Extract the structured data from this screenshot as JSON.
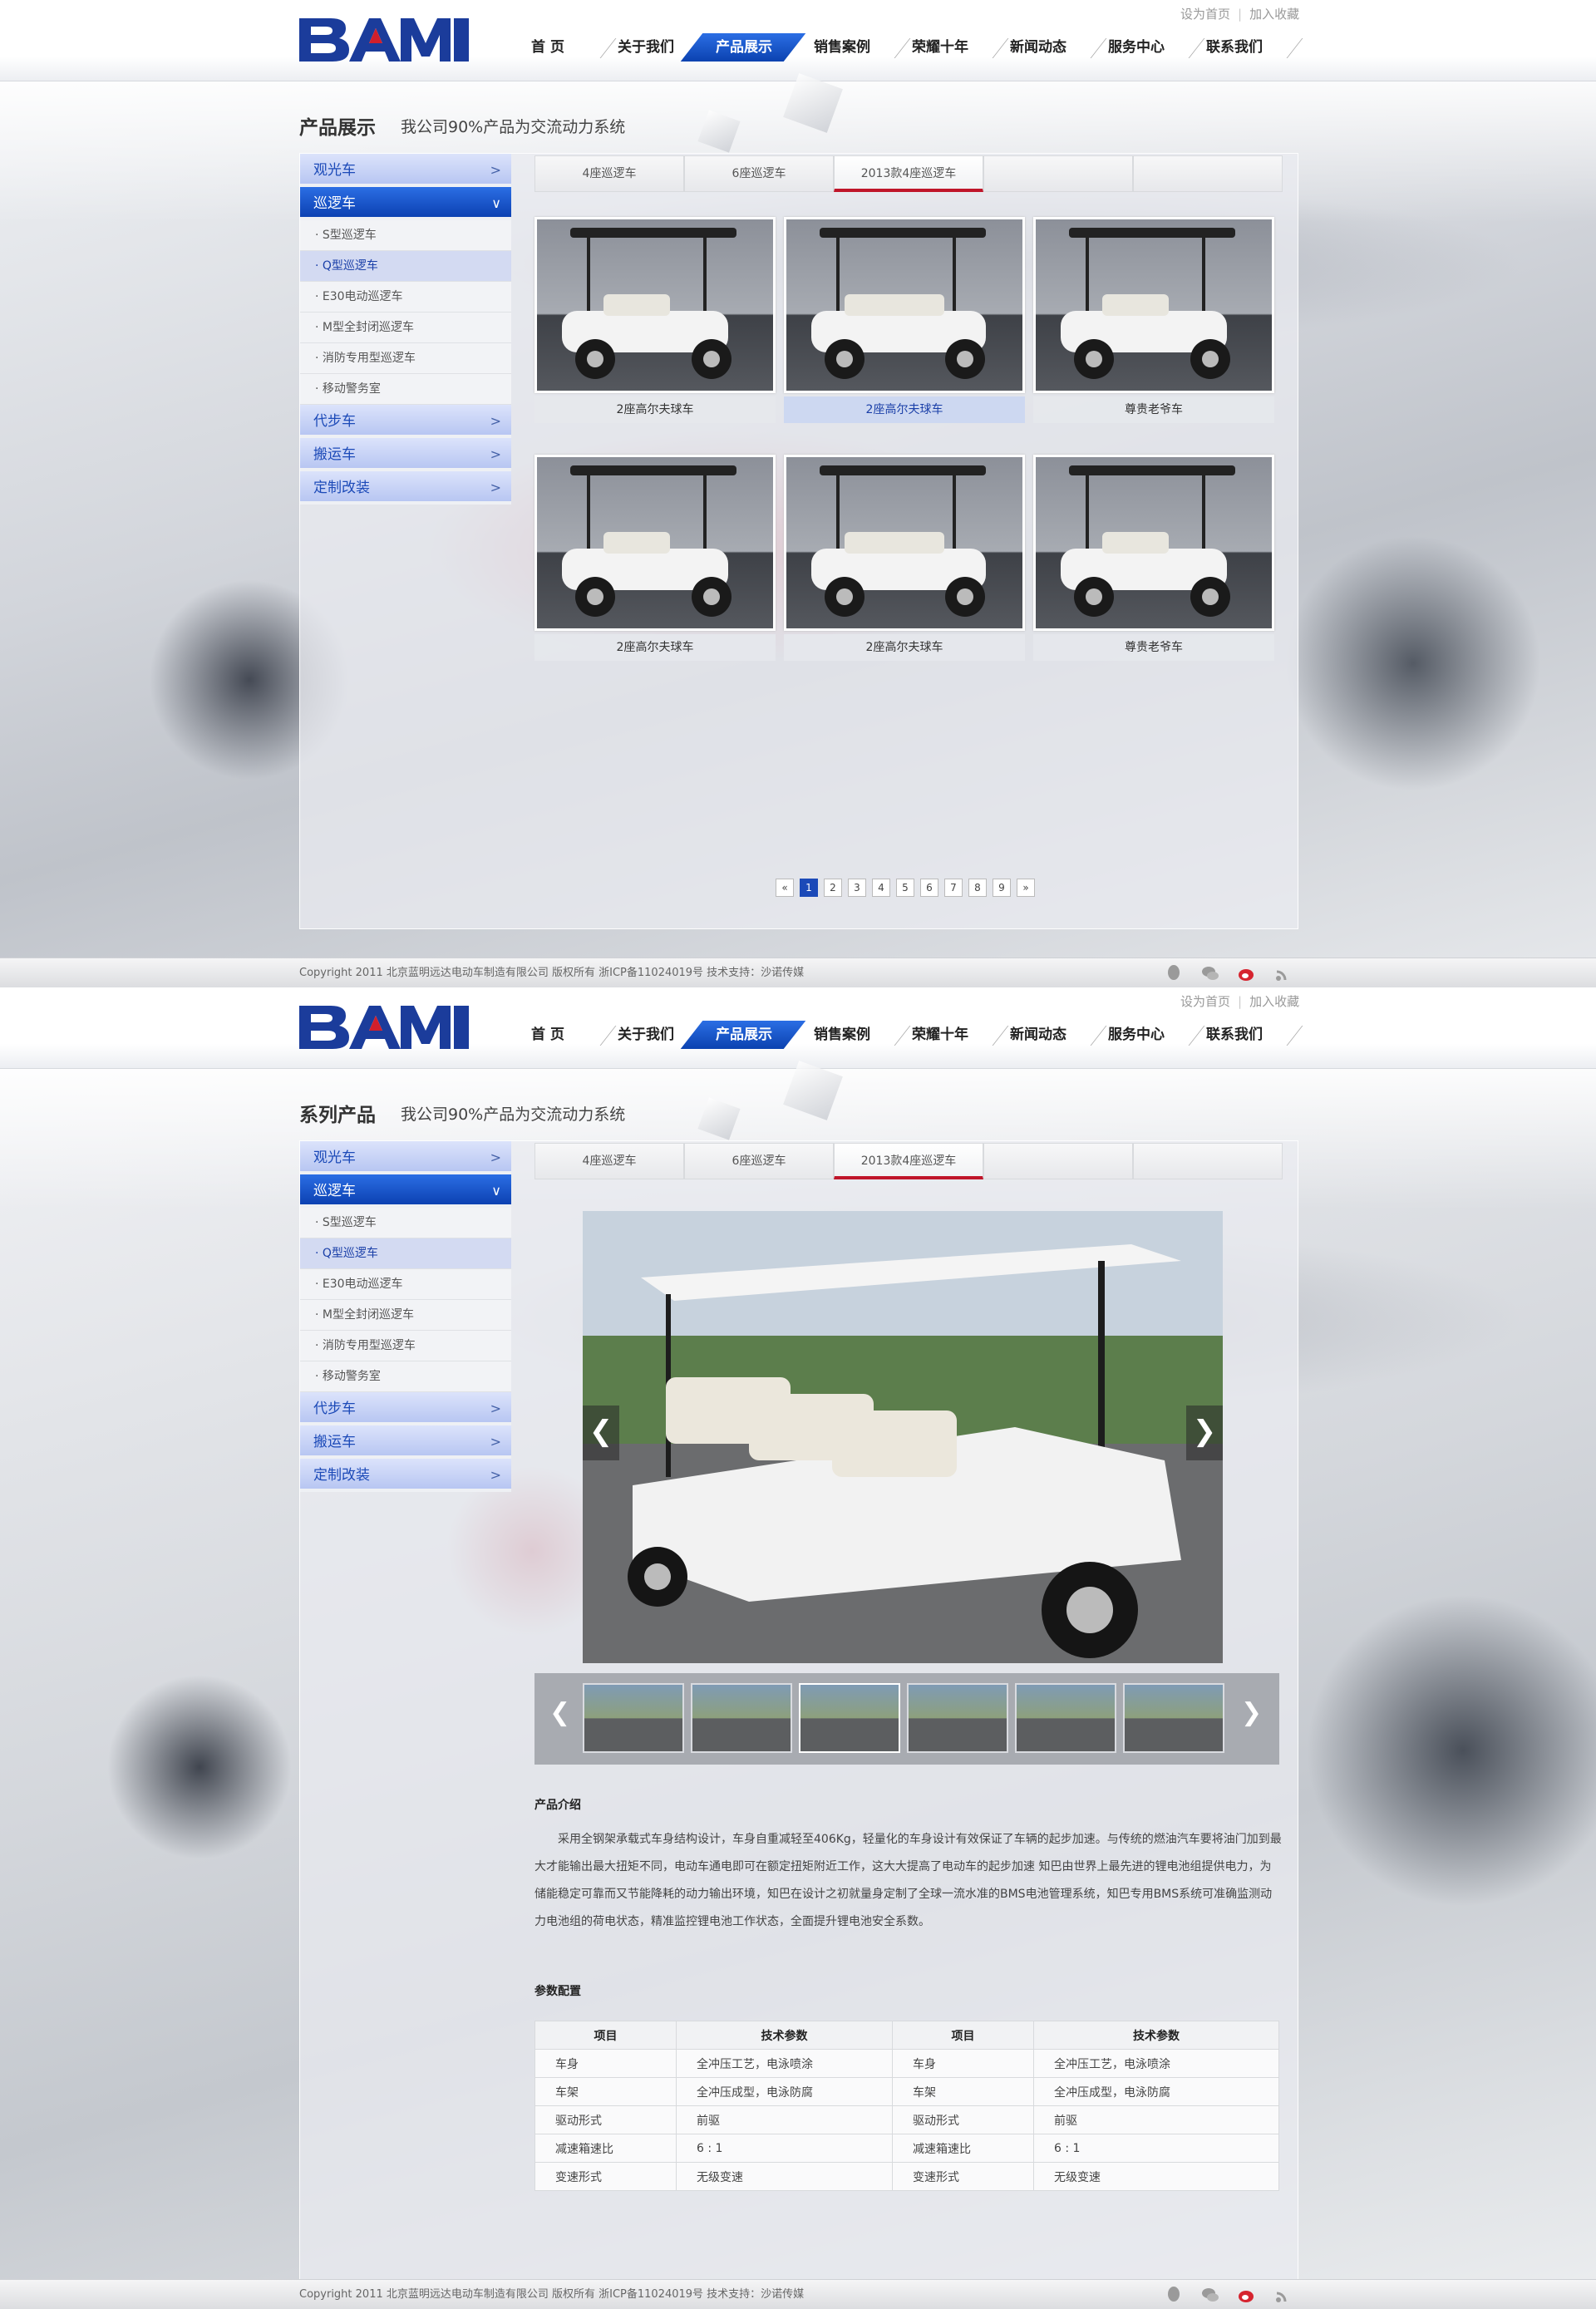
{
  "header": {
    "toplinks": [
      "设为首页",
      "加入收藏"
    ],
    "nav": [
      "首 页",
      "关于我们",
      "产品展示",
      "销售案例",
      "荣耀十年",
      "新闻动态",
      "服务中心",
      "联系我们"
    ],
    "nav_active": 2,
    "colors": {
      "brand_blue": "#1c4ab8",
      "accent_red": "#c0162a"
    }
  },
  "sidebar": {
    "categories_top": [
      {
        "label": "观光车"
      },
      {
        "label": "巡逻车",
        "open": true
      }
    ],
    "subitems": [
      {
        "label": "· S型巡逻车"
      },
      {
        "label": "· Q型巡逻车",
        "selected": true
      },
      {
        "label": "· E30电动巡逻车"
      },
      {
        "label": "· M型全封闭巡逻车"
      },
      {
        "label": "· 消防专用型巡逻车"
      },
      {
        "label": "· 移动警务室"
      }
    ],
    "categories_bottom": [
      {
        "label": "代步车"
      },
      {
        "label": "搬运车"
      },
      {
        "label": "定制改装"
      }
    ]
  },
  "tabs": [
    "4座巡逻车",
    "6座巡逻车",
    "2013款4座巡逻车",
    "",
    ""
  ],
  "tab_active": 2,
  "list_page": {
    "title": "产品展示",
    "subtitle": "我公司90%产品为交流动力系统",
    "products": [
      {
        "caption": "2座高尔夫球车"
      },
      {
        "caption": "2座高尔夫球车",
        "selected": true
      },
      {
        "caption": "尊贵老爷车"
      },
      {
        "caption": "2座高尔夫球车"
      },
      {
        "caption": "2座高尔夫球车"
      },
      {
        "caption": "尊贵老爷车"
      }
    ],
    "pagination": [
      "«",
      "1",
      "2",
      "3",
      "4",
      "5",
      "6",
      "7",
      "8",
      "9",
      "»"
    ],
    "current_page": "1"
  },
  "detail_page": {
    "title": "系列产品",
    "subtitle": "我公司90%产品为交流动力系统",
    "viewer_prev": "❮",
    "viewer_next": "❯",
    "strip_prev": "❮",
    "strip_next": "❯",
    "thumb_count": 6,
    "thumb_selected": 2,
    "intro_heading": "产品介绍",
    "intro_text": "采用全钢架承载式车身结构设计，车身自重减轻至406Kg，轻量化的车身设计有效保证了车辆的起步加速。与传统的燃油汽车要将油门加到最大才能输出最大扭矩不同，电动车通电即可在额定扭矩附近工作，这大大提高了电动车的起步加速 知巴由世界上最先进的锂电池组提供电力，为储能稳定可靠而又节能降耗的动力输出环境，知巴在设计之初就量身定制了全球一流水准的BMS电池管理系统，知巴专用BMS系统可准确监测动力电池组的荷电状态，精准监控锂电池工作状态，全面提升锂电池安全系数。",
    "spec_heading": "参数配置",
    "spec_headers": [
      "项目",
      "技术参数",
      "项目",
      "技术参数"
    ],
    "spec_rows": [
      [
        "车身",
        "全冲压工艺，电泳喷涂",
        "车身",
        "全冲压工艺，电泳喷涂"
      ],
      [
        "车架",
        "全冲压成型，电泳防腐",
        "车架",
        "全冲压成型，电泳防腐"
      ],
      [
        "驱动形式",
        "前驱",
        "驱动形式",
        "前驱"
      ],
      [
        "减速箱速比",
        "6 : 1",
        "减速箱速比",
        "6 : 1"
      ],
      [
        "变速形式",
        "无级变速",
        "变速形式",
        "无级变速"
      ]
    ]
  },
  "footer": {
    "text": "Copyright 2011 北京蓝明远达电动车制造有限公司 版权所有 浙ICP备11024019号 技术支持：沙诺传媒"
  }
}
